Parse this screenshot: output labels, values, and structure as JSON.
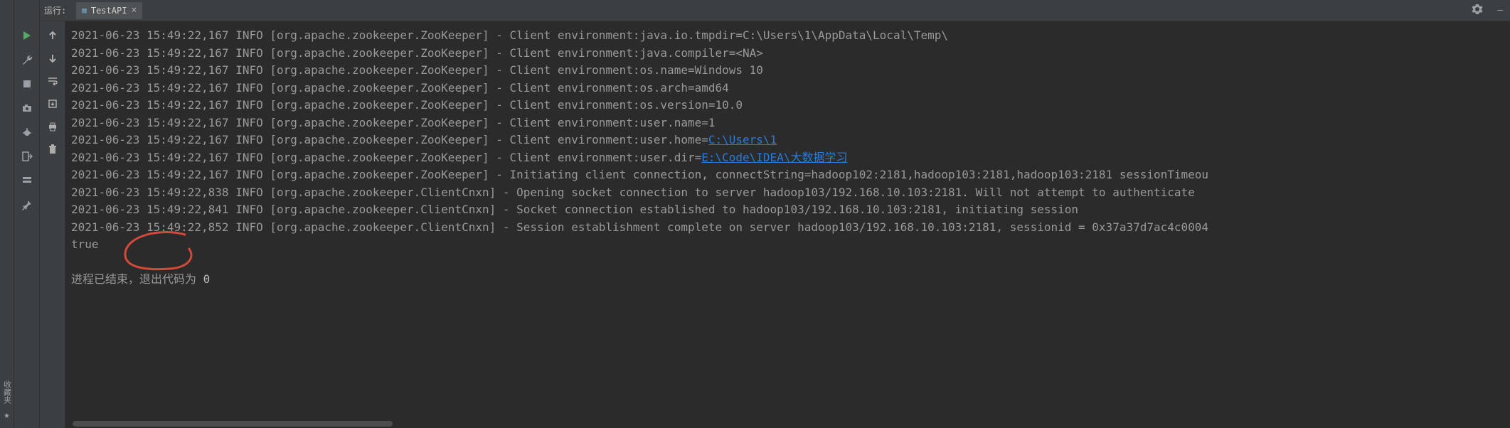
{
  "far_left": {
    "collapse_label": "收藏夹"
  },
  "tabbar": {
    "run_label": "运行:",
    "tab_name": "TestAPI"
  },
  "console": {
    "lines": [
      {
        "prefix": "2021-06-23 15:49:22,167 INFO [org.apache.zookeeper.ZooKeeper] - Client environment:java.io.tmpdir=C:\\Users\\1\\AppData\\Local\\Temp\\"
      },
      {
        "prefix": "2021-06-23 15:49:22,167 INFO [org.apache.zookeeper.ZooKeeper] - Client environment:java.compiler=<NA>"
      },
      {
        "prefix": "2021-06-23 15:49:22,167 INFO [org.apache.zookeeper.ZooKeeper] - Client environment:os.name=Windows 10"
      },
      {
        "prefix": "2021-06-23 15:49:22,167 INFO [org.apache.zookeeper.ZooKeeper] - Client environment:os.arch=amd64"
      },
      {
        "prefix": "2021-06-23 15:49:22,167 INFO [org.apache.zookeeper.ZooKeeper] - Client environment:os.version=10.0"
      },
      {
        "prefix": "2021-06-23 15:49:22,167 INFO [org.apache.zookeeper.ZooKeeper] - Client environment:user.name=1"
      },
      {
        "prefix": "2021-06-23 15:49:22,167 INFO [org.apache.zookeeper.ZooKeeper] - Client environment:user.home=",
        "link": "C:\\Users\\1"
      },
      {
        "prefix": "2021-06-23 15:49:22,167 INFO [org.apache.zookeeper.ZooKeeper] - Client environment:user.dir=",
        "link": "E:\\Code\\IDEA\\大数据学习"
      },
      {
        "prefix": "2021-06-23 15:49:22,167 INFO [org.apache.zookeeper.ZooKeeper] - Initiating client connection, connectString=hadoop102:2181,hadoop103:2181,hadoop103:2181 sessionTimeou"
      },
      {
        "prefix": "2021-06-23 15:49:22,838 INFO [org.apache.zookeeper.ClientCnxn] - Opening socket connection to server hadoop103/192.168.10.103:2181. Will not attempt to authenticate "
      },
      {
        "prefix": "2021-06-23 15:49:22,841 INFO [org.apache.zookeeper.ClientCnxn] - Socket connection established to hadoop103/192.168.10.103:2181, initiating session"
      },
      {
        "prefix": "2021-06-23 15:49:22,852 INFO [org.apache.zookeeper.ClientCnxn] - Session establishment complete on server hadoop103/192.168.10.103:2181, sessionid = 0x37a37d7ac4c0004"
      },
      {
        "prefix": "true"
      },
      {
        "prefix": ""
      },
      {
        "prefix": "进程已结束，退出代码为 ",
        "exit": "0"
      }
    ]
  }
}
